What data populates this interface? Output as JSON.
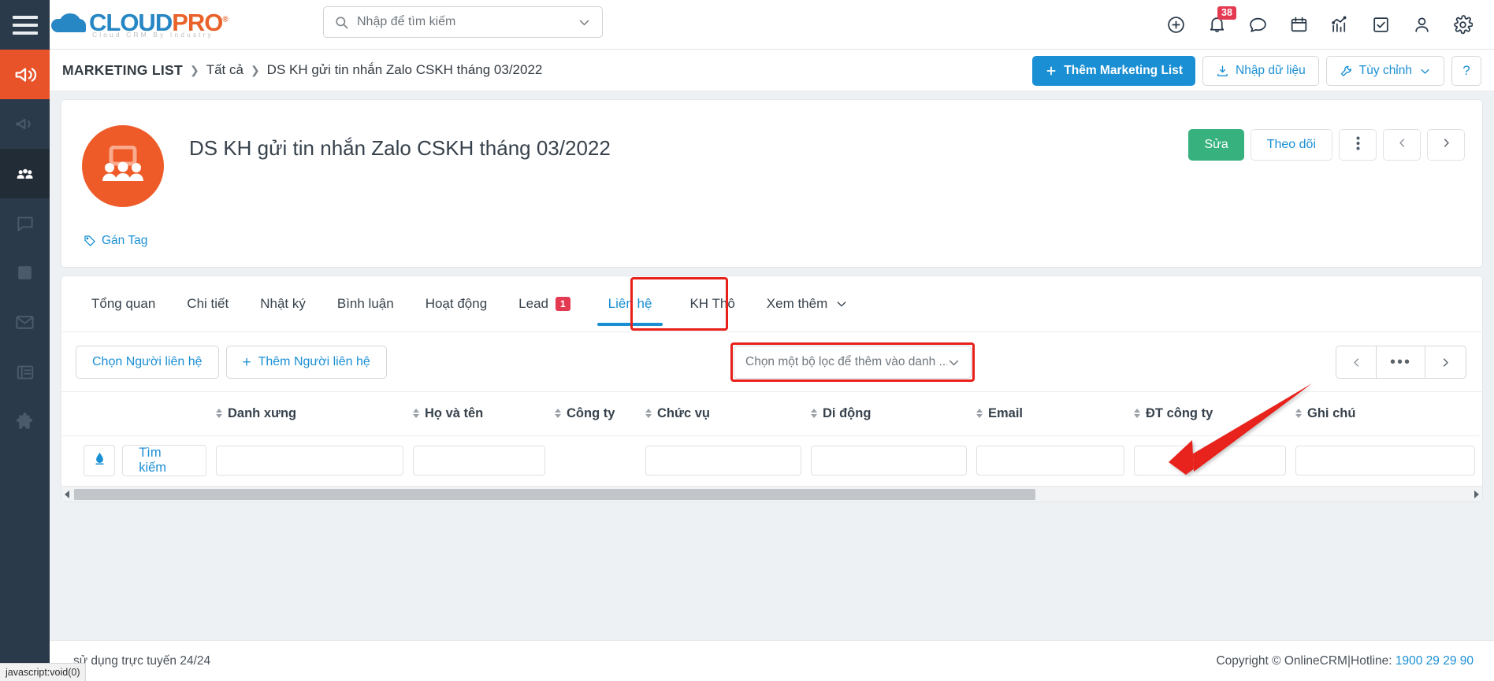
{
  "brand": {
    "name_part1": "CLOUD",
    "name_part2": "PRO",
    "registered": "®",
    "tagline": "Cloud CRM By Industry",
    "accent_blue": "#1a8fd4",
    "accent_orange": "#e8622a",
    "sidebar_bg": "#2b3a4a"
  },
  "topbar": {
    "menu_label": "menu",
    "search": {
      "value": "",
      "placeholder": "Nhập để tìm kiếm"
    },
    "icons": [
      {
        "name": "add-icon",
        "label": "Thêm mới"
      },
      {
        "name": "bell-icon",
        "label": "Thông báo",
        "badge": "38"
      },
      {
        "name": "chat-icon",
        "label": "Tin nhắn"
      },
      {
        "name": "calendar-icon",
        "label": "Lịch"
      },
      {
        "name": "chart-icon",
        "label": "Báo cáo"
      },
      {
        "name": "task-icon",
        "label": "Công việc"
      },
      {
        "name": "user-icon",
        "label": "Tài khoản"
      },
      {
        "name": "gear-icon",
        "label": "Cài đặt"
      }
    ]
  },
  "breadcrumb": {
    "root": "MARKETING LIST",
    "sep": "❯",
    "level2": "Tất cả",
    "current": "DS KH gửi tin nhắn Zalo CSKH tháng 03/2022"
  },
  "crumb_actions": {
    "add": "Thêm Marketing List",
    "add_plus": "+",
    "import": "Nhập dữ liệu",
    "customize": "Tùy chỉnh",
    "help": "?"
  },
  "record": {
    "title": "DS KH gửi tin nhắn Zalo CSKH tháng 03/2022",
    "avatar_icon": "group-people-icon",
    "tag_link": "Gán Tag",
    "actions": {
      "edit": "Sửa",
      "follow": "Theo dõi",
      "more": "⋮",
      "prev": "‹",
      "next": "›"
    }
  },
  "tabs": [
    {
      "label": "Tổng quan",
      "active": false,
      "count": null
    },
    {
      "label": "Chi tiết",
      "active": false,
      "count": null
    },
    {
      "label": "Nhật ký",
      "active": false,
      "count": null
    },
    {
      "label": "Bình luận",
      "active": false,
      "count": null
    },
    {
      "label": "Hoạt động",
      "active": false,
      "count": null
    },
    {
      "label": "Lead",
      "active": false,
      "count": "1"
    },
    {
      "label": "Liên hệ",
      "active": true,
      "count": null
    },
    {
      "label": "KH Thô",
      "active": false,
      "count": null
    },
    {
      "label": "Xem thêm",
      "active": false,
      "count": null,
      "caret": true
    }
  ],
  "toolbar": {
    "choose_contact": "Chọn Người liên hệ",
    "add_contact": "Thêm Người liên hệ",
    "add_plus": "+",
    "filter_value": "Chọn một bộ lọc để thêm vào danh ...",
    "pager": {
      "prev": "‹",
      "more": "•••",
      "next": "›"
    }
  },
  "table": {
    "columns": [
      "Danh xưng",
      "Họ và tên",
      "Công ty",
      "Chức vụ",
      "Di động",
      "Email",
      "ĐT công ty",
      "Ghi chú"
    ],
    "search_row": {
      "erase_icon": "eraser-icon",
      "search_label": "Tìm kiếm",
      "filters": [
        "",
        "",
        "",
        "",
        "",
        "",
        "",
        ""
      ]
    },
    "rows": []
  },
  "footer": {
    "left": "sử dụng trực tuyến 24/24",
    "copyright": "Copyright © OnlineCRM",
    "divider": "|",
    "hotline_label": "Hotline:",
    "hotline": "1900 29 29 90"
  },
  "statusbar": {
    "text": "javascript:void(0)"
  },
  "sidebar": {
    "items": [
      {
        "name": "campaign-icon",
        "label": "Chiến dịch",
        "active": true
      },
      {
        "name": "megaphone-icon",
        "label": "Marketing",
        "active": false
      },
      {
        "name": "people-icon",
        "label": "Danh sách",
        "active": false
      },
      {
        "name": "chat-bubble-icon",
        "label": "Trao đổi",
        "active": false
      },
      {
        "name": "book-icon",
        "label": "Tài liệu",
        "active": false
      },
      {
        "name": "mail-icon",
        "label": "Email",
        "active": false
      },
      {
        "name": "list-icon",
        "label": "Danh mục",
        "active": false
      },
      {
        "name": "puzzle-icon",
        "label": "Tiện ích",
        "active": false
      }
    ]
  },
  "annotation": {
    "arrow_color": "#e8201a",
    "highlight_color": "#e8201a"
  }
}
